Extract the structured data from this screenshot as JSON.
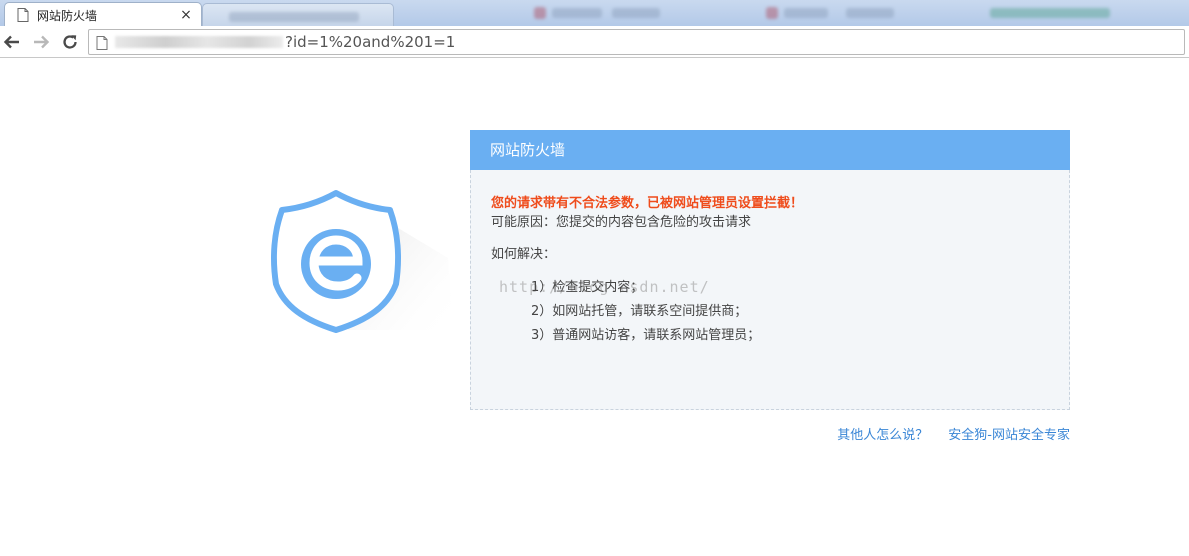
{
  "browser": {
    "tab_title": "网站防火墙",
    "tab_close": "×",
    "url_tail": "?id=1%20and%201=1"
  },
  "page": {
    "panel_title": "网站防火墙",
    "warning": "您的请求带有不合法参数，已被网站管理员设置拦截！",
    "reason": "可能原因：您提交的内容包含危险的攻击请求",
    "howto": "如何解决：",
    "steps": [
      "1）检查提交内容；",
      "2）如网站托管，请联系空间提供商；",
      "3）普通网站访客，请联系网站管理员；"
    ],
    "watermark": "http://blog.csdn.net/",
    "links": {
      "others": "其他人怎么说？",
      "brand": "安全狗-网站安全专家"
    }
  },
  "colors": {
    "header": "#6aaff2",
    "warning": "#ef4c1c",
    "link": "#3a86d6",
    "panel_bg": "#f3f6f9"
  }
}
